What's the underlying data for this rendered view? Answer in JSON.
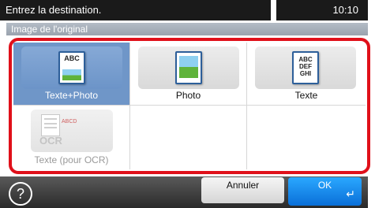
{
  "header": {
    "prompt": "Entrez la destination.",
    "time": "10:10"
  },
  "section": {
    "title": "Image de l'original"
  },
  "options": [
    {
      "label": "Texte+Photo",
      "icon": "text-photo-icon",
      "icon_text": "ABC",
      "state": "selected"
    },
    {
      "label": "Photo",
      "icon": "photo-icon",
      "icon_text": "",
      "state": "normal"
    },
    {
      "label": "Texte",
      "icon": "text-icon",
      "icon_text": "ABC DEF GHI",
      "state": "normal"
    },
    {
      "label": "Texte (pour OCR)",
      "icon": "ocr-icon",
      "icon_text": "OCR",
      "state": "disabled"
    }
  ],
  "ocr_icon_sample": "ABCD",
  "footer": {
    "help_symbol": "?",
    "cancel_label": "Annuler",
    "ok_label": "OK",
    "enter_symbol": "↵"
  },
  "colors": {
    "highlight_border": "#e0101a",
    "selected_bg": "#6f96c8",
    "ok_blue": "#1a8ae8"
  }
}
